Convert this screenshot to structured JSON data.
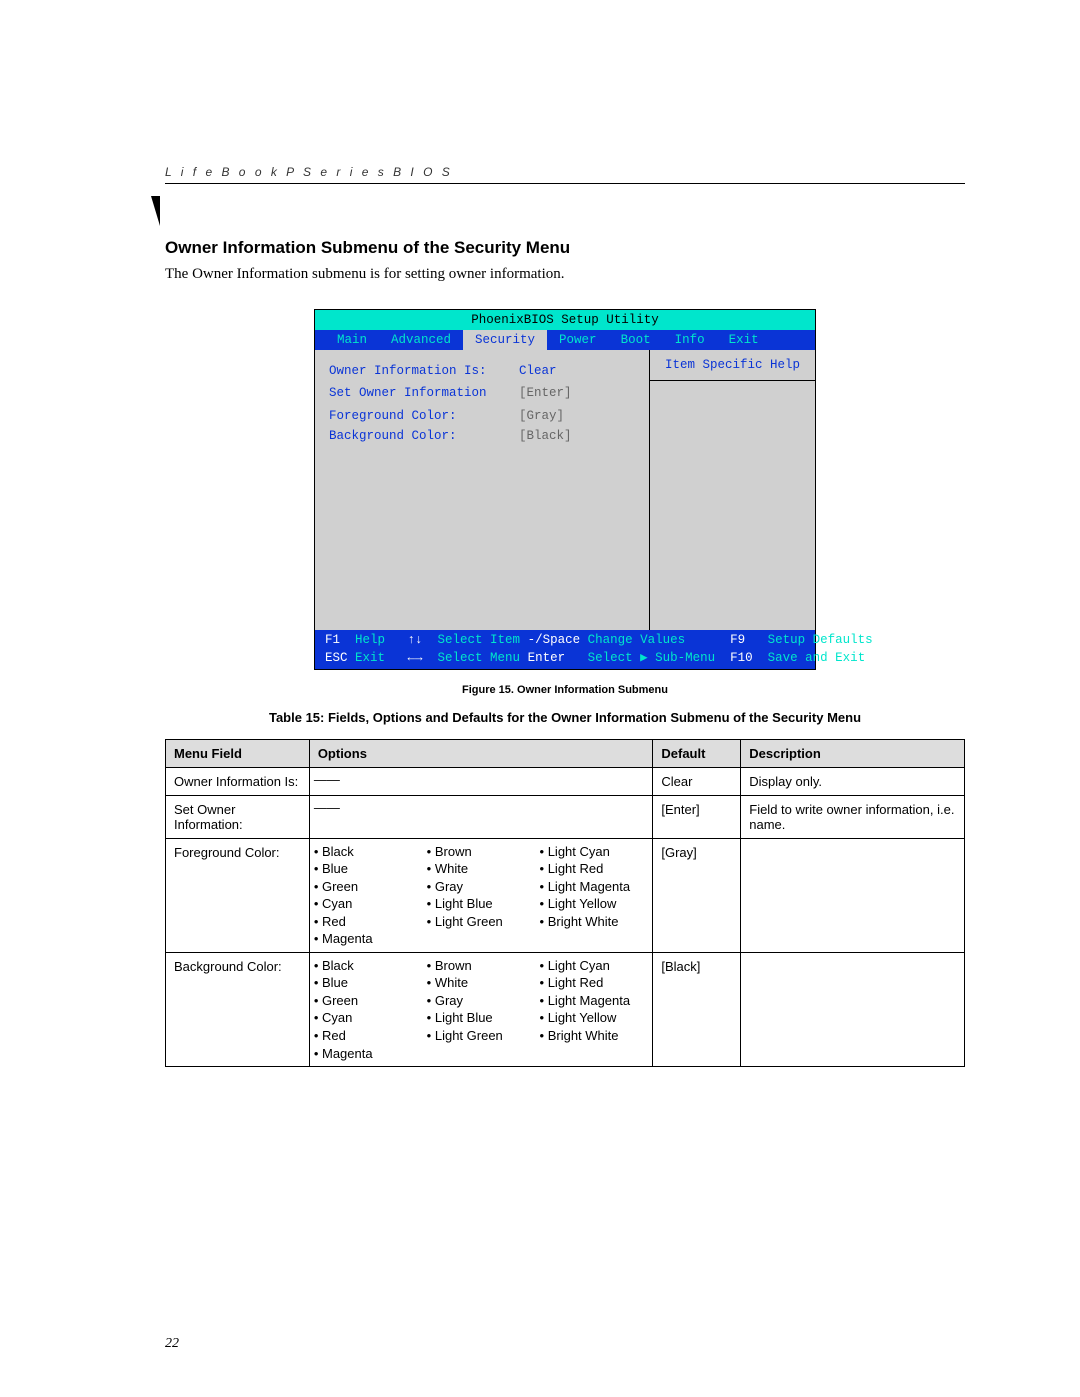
{
  "header_text": "L i f e B o o k   P   S e r i e s   B I O S",
  "section_title": "Owner Information Submenu of the Security Menu",
  "section_intro": "The Owner Information submenu is for setting owner information.",
  "bios": {
    "title": "PhoenixBIOS Setup Utility",
    "tabs": [
      "Main",
      "Advanced",
      "Security",
      "Power",
      "Boot",
      "Info",
      "Exit"
    ],
    "active_tab_index": 2,
    "fields": [
      {
        "label": "Owner Information Is:",
        "value": "Clear",
        "gray": false
      },
      {
        "label": "",
        "value": "",
        "gray": false
      },
      {
        "label": "Set Owner Information",
        "value": "[Enter]",
        "gray": true
      },
      {
        "label": "",
        "value": "",
        "gray": false
      },
      {
        "label": "Foreground Color:",
        "value": "[Gray]",
        "gray": true
      },
      {
        "label": "Background Color:",
        "value": "[Black]",
        "gray": true
      }
    ],
    "help_title": "Item Specific Help",
    "footer": [
      {
        "k1": "F1",
        "t1": "Help",
        "k2": "↑↓",
        "t2": "Select Item",
        "k3": "-/Space",
        "t3": "Change Values",
        "k4": "F9",
        "t4": "Setup Defaults"
      },
      {
        "k1": "ESC",
        "t1": "Exit",
        "k2": "←→",
        "t2": "Select Menu",
        "k3": "Enter",
        "t3": "Select ▶ Sub-Menu",
        "k4": "F10",
        "t4": "Save and Exit"
      }
    ]
  },
  "figure_caption": "Figure 15.   Owner Information Submenu",
  "table_caption": "Table 15: Fields, Options and Defaults for the Owner Information Submenu of the Security Menu",
  "table_headers": [
    "Menu Field",
    "Options",
    "Default",
    "Description"
  ],
  "color_options": [
    [
      "Black",
      "Blue",
      "Green",
      "Cyan",
      "Red",
      "Magenta"
    ],
    [
      "Brown",
      "White",
      "Gray",
      "Light Blue",
      "Light Green"
    ],
    [
      "Light Cyan",
      "Light Red",
      "Light Magenta",
      "Light Yellow",
      "Bright White"
    ]
  ],
  "table_rows": [
    {
      "field": "Owner Information Is:",
      "options_type": "dash",
      "default": "Clear",
      "desc": "Display only."
    },
    {
      "field": "Set Owner Information:",
      "options_type": "dash",
      "default": "[Enter]",
      "desc": "Field to write owner information, i.e. name."
    },
    {
      "field": "Foreground Color:",
      "options_type": "colors",
      "default": "[Gray]",
      "desc": ""
    },
    {
      "field": "Background Color:",
      "options_type": "colors",
      "default": "[Black]",
      "desc": ""
    }
  ],
  "page_number": "22"
}
